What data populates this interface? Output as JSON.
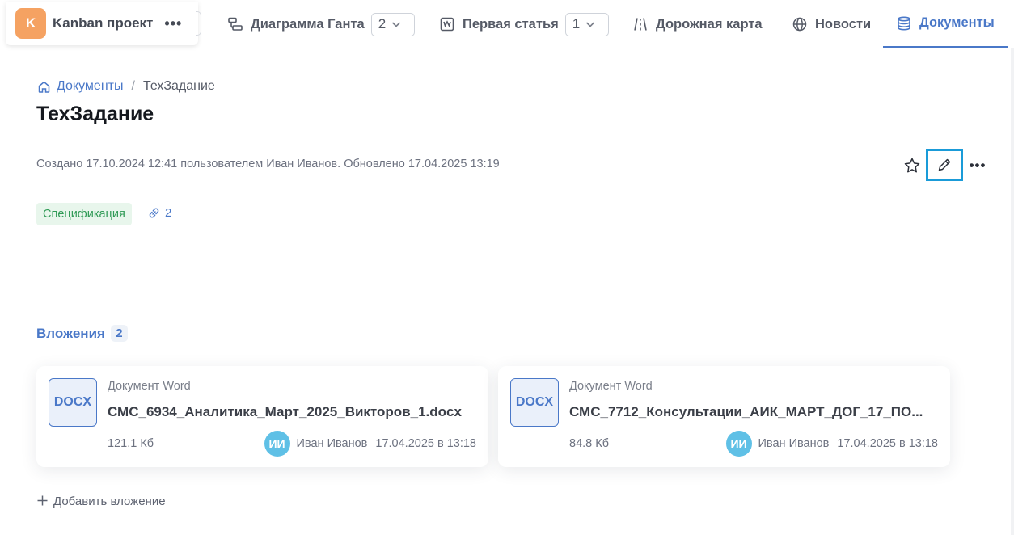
{
  "project": {
    "avatar_letter": "K",
    "name": "Kanban проект",
    "more": "•••"
  },
  "tabs": [
    {
      "label": "Диаграмма Ганта",
      "counter": "2",
      "icon": "gantt-icon"
    },
    {
      "label": "Первая статья",
      "counter": "1",
      "icon": "article-icon"
    },
    {
      "label": "Дорожная карта",
      "icon": "roadmap-icon"
    },
    {
      "label": "Новости",
      "icon": "globe-icon"
    },
    {
      "label": "Документы",
      "icon": "documents-icon",
      "active": true
    }
  ],
  "breadcrumb": {
    "root": "Документы",
    "separator": "/",
    "current": "ТехЗадание"
  },
  "document": {
    "title": "ТехЗадание",
    "meta": "Создано 17.10.2024 12:41 пользователем Иван Иванов. Обновлено 17.04.2025 13:19",
    "tag": "Спецификация",
    "links_count": "2"
  },
  "actions": {
    "more": "•••"
  },
  "attachments": {
    "title": "Вложения",
    "count": "2",
    "items": [
      {
        "badge": "DOCX",
        "type": "Документ Word",
        "name": "СМС_6934_Аналитика_Март_2025_Викторов_1.docx",
        "size": "121.1 Кб",
        "owner_initials": "ИИ",
        "owner": "Иван Иванов",
        "date": "17.04.2025 в 13:18"
      },
      {
        "badge": "DOCX",
        "type": "Документ Word",
        "name": "СМС_7712_Консультации_АИК_МАРТ_ДОГ_17_ПО...",
        "size": "84.8 Кб",
        "owner_initials": "ИИ",
        "owner": "Иван Иванов",
        "date": "17.04.2025 в 13:18"
      }
    ],
    "add_label": "Добавить вложение"
  },
  "colors": {
    "accent": "#4a78c8",
    "project_avatar": "#f5a262",
    "tag_bg": "#e8f6ec",
    "tag_text": "#2f9a55",
    "highlight": "#1a9bd8",
    "owner_avatar": "#5fc0e6"
  }
}
